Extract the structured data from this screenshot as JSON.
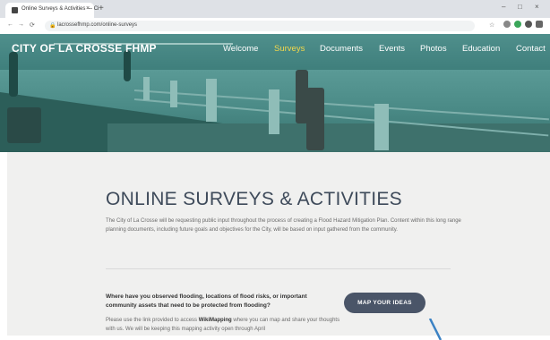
{
  "browser": {
    "tab_title": "Online Surveys & Activities — Ci",
    "tab_close": "×",
    "new_tab": "+",
    "url": "lacrossefhmp.com/online-surveys",
    "win_min": "–",
    "win_max": "□",
    "win_close": "×"
  },
  "site": {
    "logo": "CITY OF LA CROSSE FHMP",
    "nav": [
      {
        "label": "Welcome"
      },
      {
        "label": "Surveys"
      },
      {
        "label": "Documents"
      },
      {
        "label": "Events"
      },
      {
        "label": "Photos"
      },
      {
        "label": "Education"
      },
      {
        "label": "Contact"
      }
    ],
    "accent": "#f3d84a",
    "hero_tint": "#3f7f7c"
  },
  "content": {
    "title": "ONLINE SURVEYS & ACTIVITIES",
    "intro": "The City of La Crosse will be requesting public input throughout the process of creating a Flood Hazard Mitigation Plan. Content within this long range planning documents, including future goals and objectives for the City, will be based on input gathered from the community.",
    "question": "Where have you observed flooding, locations of flood risks, or important community assets that need to be protected from flooding?",
    "body_prefix": "Please use the link provided to access ",
    "body_link": "WikiMapping",
    "body_suffix": " where you can map and share your thoughts with us.  We will be keeping this mapping activity open through April",
    "button": "MAP YOUR IDEAS",
    "button_color": "#4a5568"
  }
}
